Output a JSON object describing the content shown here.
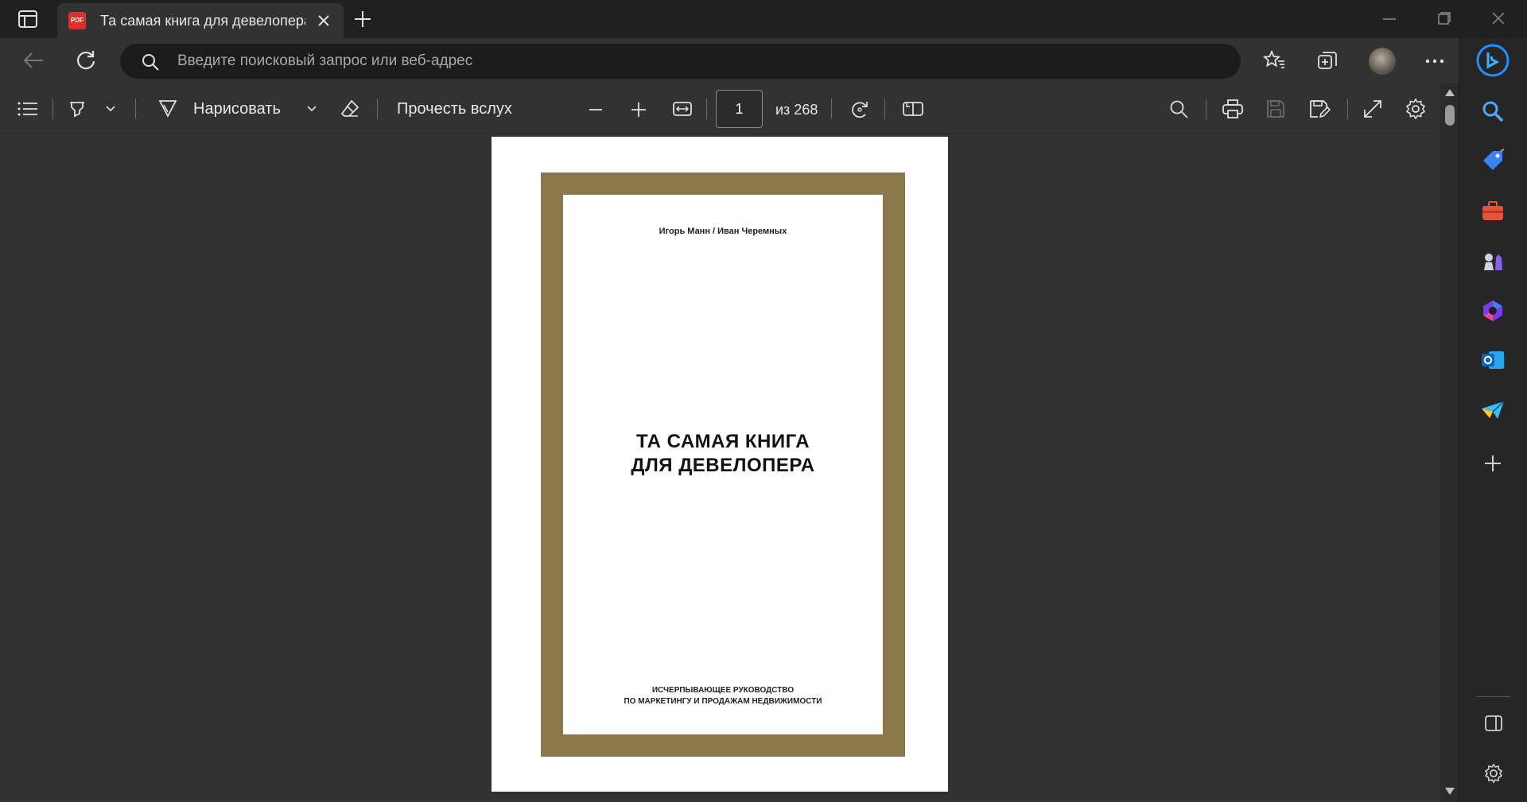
{
  "tab": {
    "title": "Та самая книга для девелопера",
    "badge": "PDF"
  },
  "address_bar": {
    "placeholder": "Введите поисковый запрос или веб-адрес"
  },
  "pdf_toolbar": {
    "draw_label": "Нарисовать",
    "read_aloud_label": "Прочесть вслух",
    "current_page": "1",
    "total_pages_label": "из 268"
  },
  "document": {
    "authors": "Игорь Манн / Иван Черемных",
    "title_line1": "ТА САМАЯ КНИГА",
    "title_line2": "ДЛЯ ДЕВЕЛОПЕРА",
    "subtitle_line1": "ИСЧЕРПЫВАЮЩЕЕ РУКОВОДСТВО",
    "subtitle_line2": "ПО МАРКЕТИНГУ И ПРОДАЖАМ НЕДВИЖИМОСТИ"
  },
  "colors": {
    "frame": "#8b784a",
    "accent_blue": "#1e90ff",
    "chrome_dark": "#202020",
    "toolbar": "#323232"
  }
}
